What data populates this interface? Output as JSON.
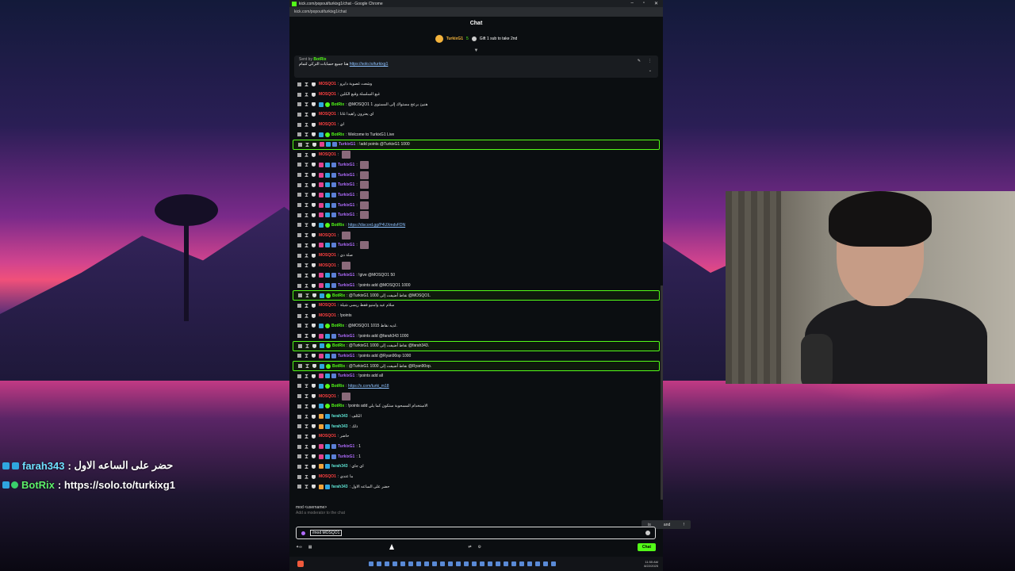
{
  "window": {
    "title": "kick.com/popout/turkixg1/chat - Google Chrome",
    "url": "kick.com/popout/turkixg1/chat",
    "controls": [
      "–",
      "▫",
      "✕"
    ]
  },
  "chat": {
    "header": "Chat",
    "goal": {
      "rank": "1",
      "user": "TurkixG1",
      "count": "5",
      "text": "Gift 1 sub to take 2nd"
    },
    "pinned": {
      "by_label": "Sent by",
      "by_user": "BotRix",
      "text": "هنا جميع حسابات التركي لتمام",
      "link": "https://solo.to/turkixg1"
    },
    "messages": [
      {
        "user": "MOSQO1",
        "color": "red",
        "badges": [],
        "text": "وشعت غصوبة دايرو"
      },
      {
        "user": "MOSQO1",
        "color": "red",
        "badges": [],
        "text": "غبع السلسلة وقبع الكلين"
      },
      {
        "user": "BotRix",
        "color": "green",
        "badges": [
          "sub",
          "bot"
        ],
        "text": "@MOSQO1 هنيئ برعح مستواك إلى المستوى 1"
      },
      {
        "user": "MOSQO1",
        "color": "red",
        "badges": [],
        "text": "اي يعترون راهيدا غانا"
      },
      {
        "user": "MOSQO1",
        "color": "red",
        "badges": [],
        "text": "اي"
      },
      {
        "user": "BotRix",
        "color": "green",
        "badges": [
          "sub",
          "bot"
        ],
        "text": "Welcome to TurkixG1 Live"
      },
      {
        "user": "TurkixG1",
        "color": "purple",
        "badges": [
          "vip",
          "sub",
          "og"
        ],
        "text": "!add points @TurkixG1 1000",
        "highlight": true
      },
      {
        "user": "MOSQO1",
        "color": "red",
        "badges": [],
        "text": "",
        "emote": true
      },
      {
        "user": "TurkixG1",
        "color": "purple",
        "badges": [
          "vip",
          "sub",
          "og"
        ],
        "text": "",
        "emote": true
      },
      {
        "user": "TurkixG1",
        "color": "purple",
        "badges": [
          "vip",
          "sub",
          "og"
        ],
        "text": "",
        "emote": true
      },
      {
        "user": "TurkixG1",
        "color": "purple",
        "badges": [
          "vip",
          "sub",
          "og"
        ],
        "text": "",
        "emote": true
      },
      {
        "user": "TurkixG1",
        "color": "purple",
        "badges": [
          "vip",
          "sub",
          "og"
        ],
        "text": "",
        "emote": true
      },
      {
        "user": "TurkixG1",
        "color": "purple",
        "badges": [
          "vip",
          "sub",
          "og"
        ],
        "text": "",
        "emote": true
      },
      {
        "user": "TurkixG1",
        "color": "purple",
        "badges": [
          "vip",
          "sub",
          "og"
        ],
        "text": "",
        "emote": true
      },
      {
        "user": "BotRix",
        "color": "green",
        "badges": [
          "sub",
          "bot"
        ],
        "text": "",
        "link": "https://discord.gg/P4UXmdvFDN"
      },
      {
        "user": "MOSQO1",
        "color": "red",
        "badges": [],
        "text": "",
        "emote": true
      },
      {
        "user": "TurkixG1",
        "color": "purple",
        "badges": [
          "vip",
          "sub",
          "og"
        ],
        "text": "",
        "emote": true
      },
      {
        "user": "MOSQO1",
        "color": "red",
        "badges": [],
        "text": "صلة دي"
      },
      {
        "user": "MOSQO1",
        "color": "red",
        "badges": [],
        "text": "",
        "emote": true
      },
      {
        "user": "TurkixG1",
        "color": "purple",
        "badges": [
          "vip",
          "sub",
          "og"
        ],
        "text": "!give @MOSQO1 50"
      },
      {
        "user": "TurkixG1",
        "color": "purple",
        "badges": [
          "vip",
          "sub",
          "og"
        ],
        "text": "!points add @MOSQO1 1000"
      },
      {
        "user": "BotRix",
        "color": "green",
        "badges": [
          "sub",
          "bot"
        ],
        "text": "@TurkixG1 1000 نقاط أضيفت إلى @MOSQO1.",
        "highlight": true
      },
      {
        "user": "MOSQO1",
        "color": "red",
        "badges": [],
        "text": "سلام عيد وامنيو فقط ريسى شيلة"
      },
      {
        "user": "MOSQO1",
        "color": "red",
        "badges": [],
        "text": "!points"
      },
      {
        "user": "BotRix",
        "color": "green",
        "badges": [
          "sub",
          "bot"
        ],
        "text": "@MOSQO1 1015 لديه نقاط."
      },
      {
        "user": "TurkixG1",
        "color": "purple",
        "badges": [
          "vip",
          "sub",
          "og"
        ],
        "text": "!points add @farah343 1000"
      },
      {
        "user": "BotRix",
        "color": "green",
        "badges": [
          "sub",
          "bot"
        ],
        "text": "@TurkixG1 1000 نقاط أضيفت إلى @farah343.",
        "highlight": true
      },
      {
        "user": "TurkixG1",
        "color": "purple",
        "badges": [
          "vip",
          "sub",
          "og"
        ],
        "text": "!points add @Ryan90op 1000"
      },
      {
        "user": "BotRix",
        "color": "green",
        "badges": [
          "sub",
          "bot"
        ],
        "text": "@TurkixG1 1000 نقاط أضيفت إلى @Ryan90op.",
        "highlight": true
      },
      {
        "user": "TurkixG1",
        "color": "purple",
        "badges": [
          "vip",
          "sub",
          "og"
        ],
        "text": "!points add all"
      },
      {
        "user": "BotRix",
        "color": "green",
        "badges": [
          "sub",
          "bot"
        ],
        "text": "",
        "link": "https://x.com/turki_m18"
      },
      {
        "user": "MOSQO1",
        "color": "red",
        "badges": [],
        "text": "",
        "emote": true
      },
      {
        "user": "BotRix",
        "color": "green",
        "badges": [
          "sub",
          "bot"
        ],
        "text": "!points add الاستخدام المسحوبة ستكون كما يلي"
      },
      {
        "user": "farah343",
        "color": "teal",
        "badges": [
          "crown",
          "sub"
        ],
        "text": "الكلف"
      },
      {
        "user": "farah343",
        "color": "teal",
        "badges": [
          "crown",
          "sub"
        ],
        "text": "ذلك"
      },
      {
        "user": "MOSQO1",
        "color": "red",
        "badges": [],
        "text": "حاضر"
      },
      {
        "user": "TurkixG1",
        "color": "purple",
        "badges": [
          "vip",
          "sub",
          "og"
        ],
        "text": "1"
      },
      {
        "user": "TurkixG1",
        "color": "purple",
        "badges": [
          "vip",
          "sub",
          "og"
        ],
        "text": "1"
      },
      {
        "user": "farah343",
        "color": "teal",
        "badges": [
          "crown",
          "sub"
        ],
        "text": "اي جاي"
      },
      {
        "user": "MOSQO1",
        "color": "red",
        "badges": [],
        "text": "ما عندي"
      },
      {
        "user": "farah343",
        "color": "teal",
        "badges": [
          "crown",
          "sub"
        ],
        "text": "حضر على الساعه الاول"
      }
    ],
    "suggest": {
      "cmd": "mod <username>",
      "desc": "Add a moderator to the chat"
    },
    "popup": [
      "is",
      "and",
      "!"
    ],
    "input_value": "/mod MOSQO1",
    "send_label": "Chat"
  },
  "overlay": [
    {
      "user": "farah343",
      "text": "حضر على الساعه الاول"
    },
    {
      "user": "BotRix",
      "text": "https://solo.to/turkixg1"
    }
  ],
  "taskbar": {
    "time": "11:55 AM",
    "date": "8/22/2025"
  }
}
